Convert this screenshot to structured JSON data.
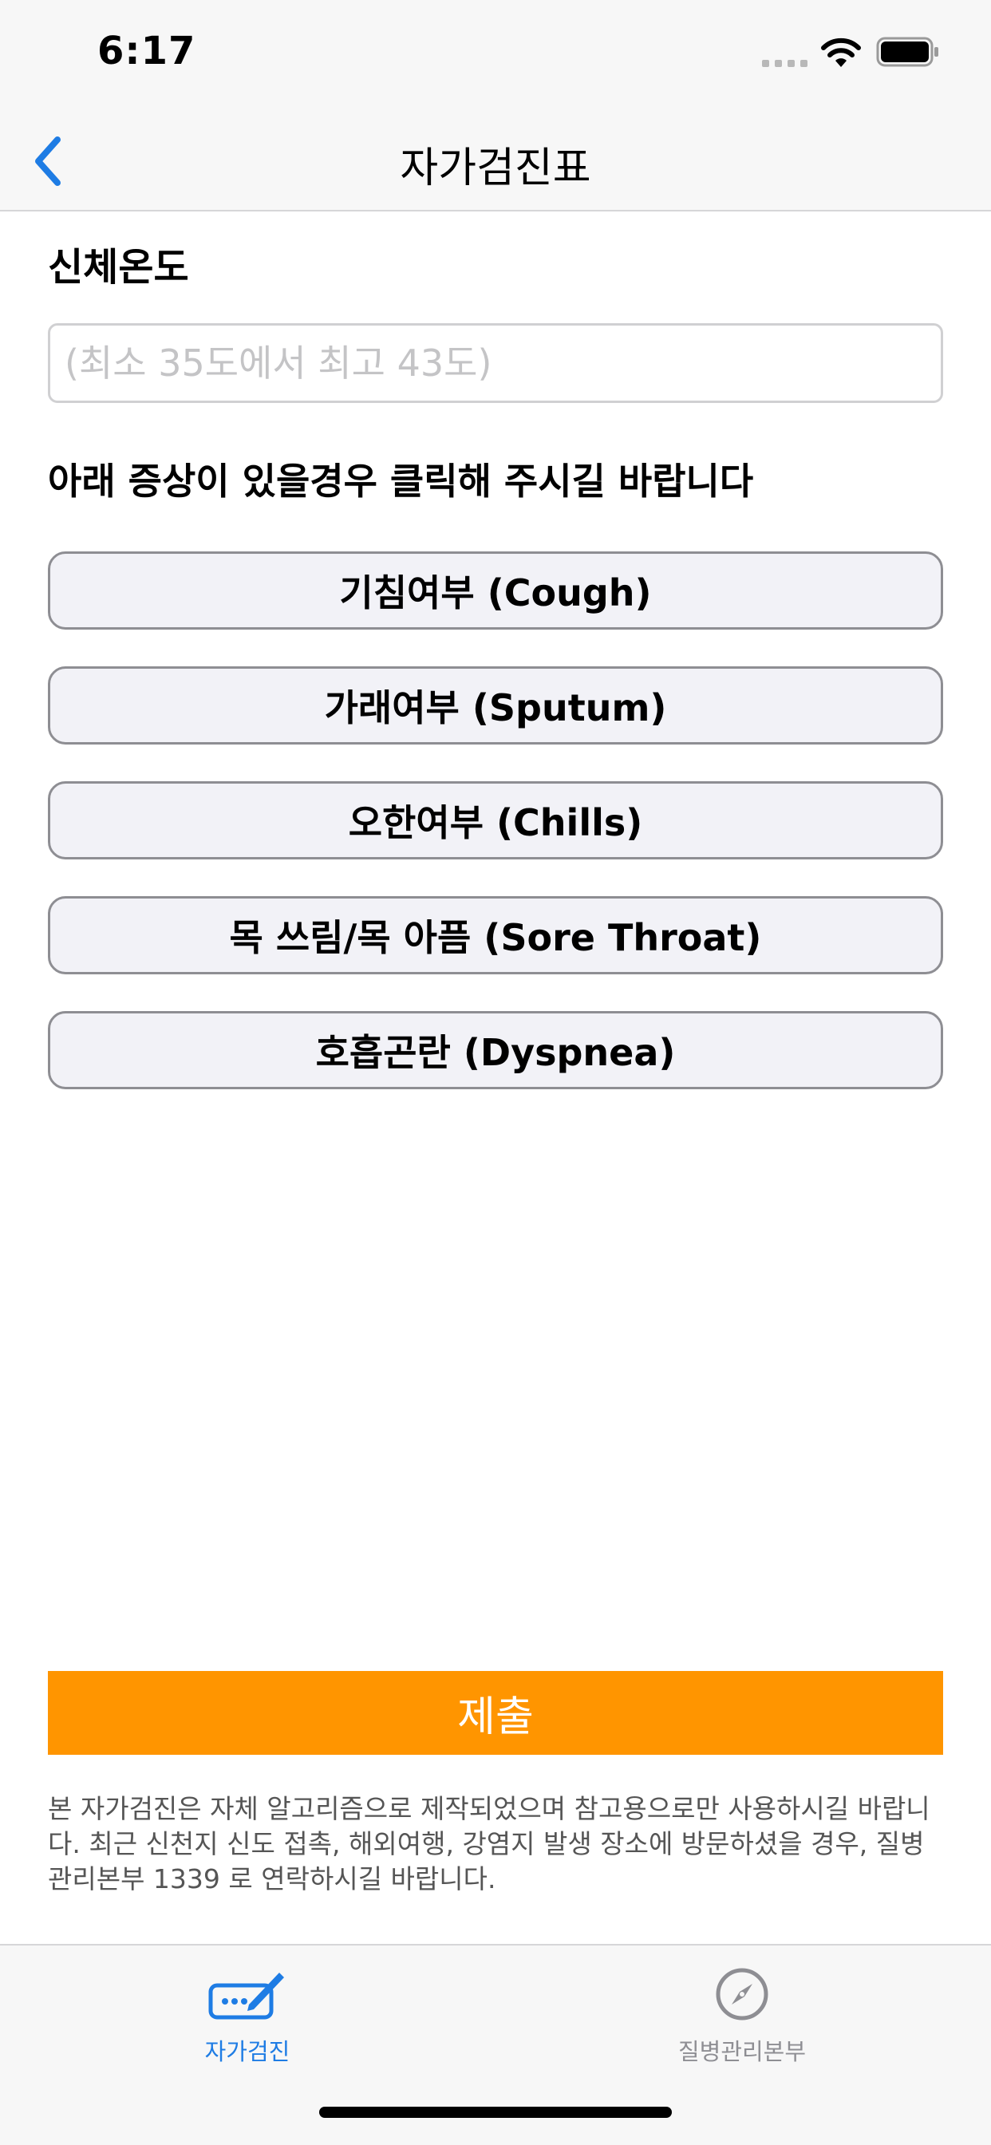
{
  "status_bar": {
    "time": "6:17",
    "icons": [
      "signal-icon",
      "wifi-icon",
      "battery-icon"
    ]
  },
  "nav": {
    "title": "자가검진표",
    "back_icon": "chevron-left-icon",
    "accent_color": "#1e7ce4"
  },
  "form": {
    "temperature_label": "신체온도",
    "temperature_placeholder": "(최소 35도에서 최고 43도)",
    "temperature_value": "",
    "instruction": "아래 증상이 있을경우 클릭해 주시길 바랍니다",
    "symptoms": [
      "기침여부 (Cough)",
      "가래여부 (Sputum)",
      "오한여부 (Chills)",
      "목 쓰림/목 아픔 (Sore Throat)",
      "호흡곤란 (Dyspnea)"
    ],
    "submit_label": "제출",
    "submit_color": "#ff9500",
    "disclaimer": "본 자가검진은 자체 알고리즘으로 제작되었으며 참고용으로만 사용하시길 바랍니다. 최근 신천지 신도 접촉, 해외여행, 강염지 발생 장소에 방문하셨을 경우, 질병관리본부 1339 로 연락하시길 바랍니다."
  },
  "tab_bar": {
    "tabs": [
      {
        "label": "자가검진",
        "icon": "edit-form-icon",
        "selected": true
      },
      {
        "label": "질병관리본부",
        "icon": "compass-icon",
        "selected": false
      }
    ]
  }
}
